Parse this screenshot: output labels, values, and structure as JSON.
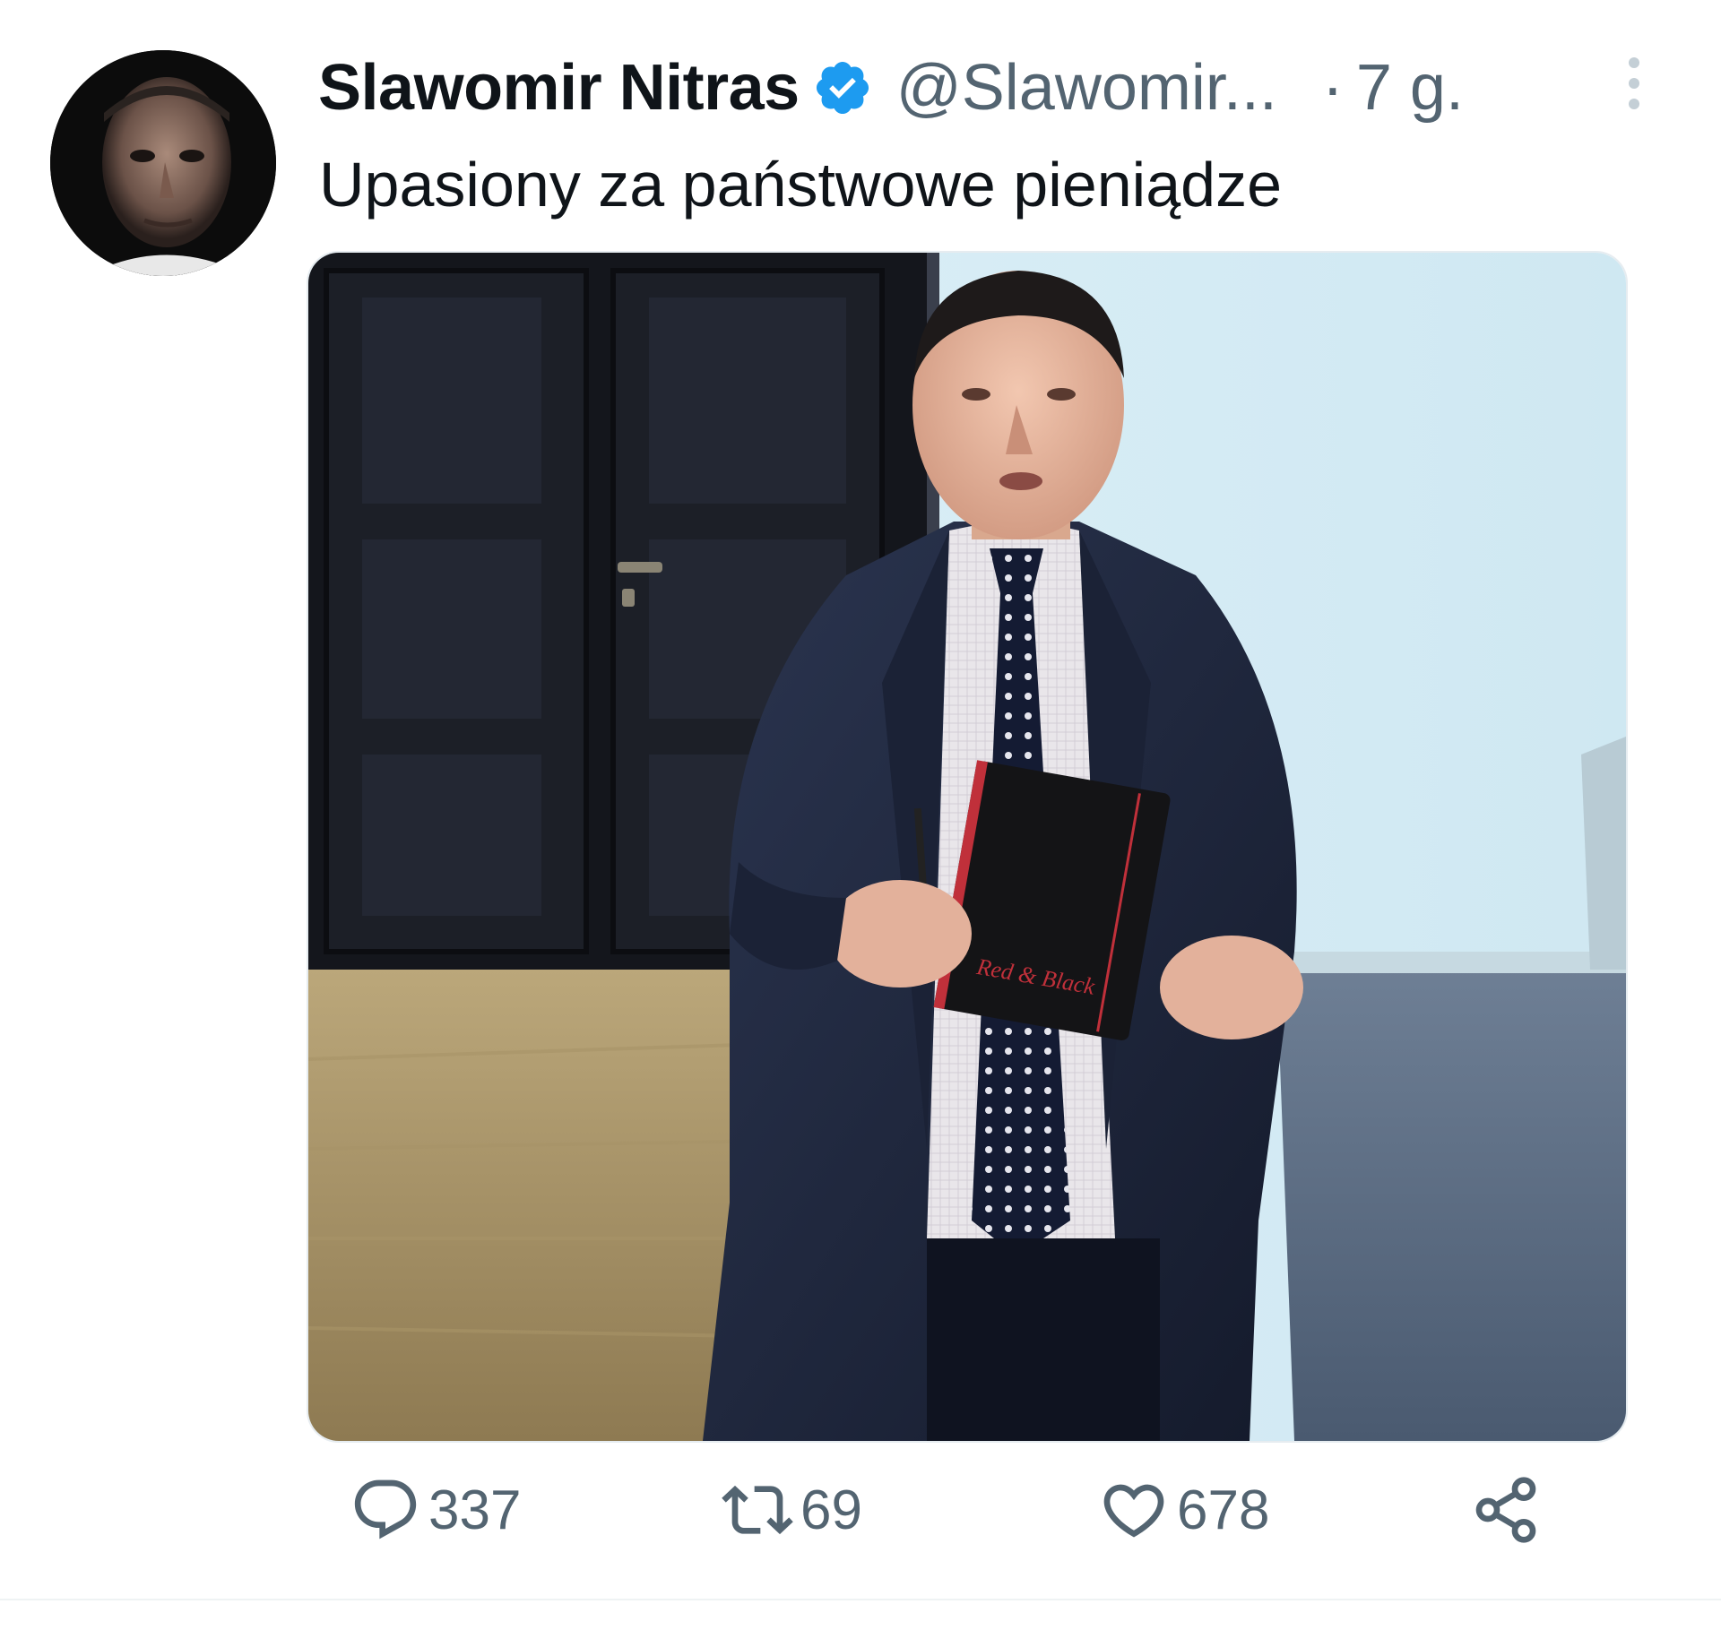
{
  "tweet": {
    "author": {
      "display_name": "Slawomir Nitras",
      "handle": "@Slawomir...",
      "verified": true,
      "avatar_icon": "avatar-photo"
    },
    "separator": "·",
    "timestamp": "7 g.",
    "text": "Upasiony za państwowe pieniądze",
    "media": {
      "type": "photo",
      "notebook_label": "Red & Black"
    },
    "actions": {
      "replies": "337",
      "retweets": "69",
      "likes": "678",
      "share_icon": "share-icon"
    }
  },
  "colors": {
    "text_primary": "#0f1419",
    "text_secondary": "#536471",
    "verified_blue": "#1d9bf0",
    "divider": "#eff3f4"
  }
}
